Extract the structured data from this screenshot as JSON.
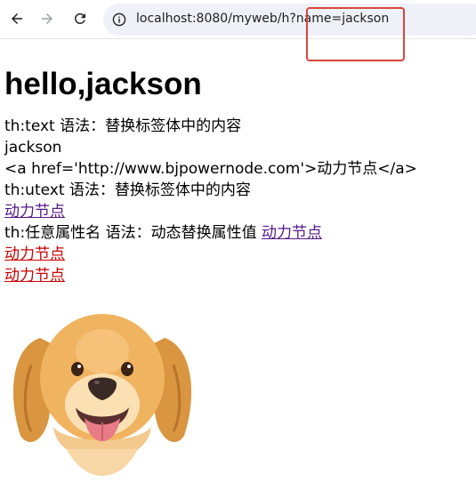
{
  "browser": {
    "url": "localhost:8080/myweb/h?name=jackson"
  },
  "page": {
    "heading": "hello,jackson",
    "lines": [
      "th:text 语法：替换标签体中的内容",
      "jackson",
      "<a href='http://www.bjpowernode.com'>动力节点</a>",
      "th:utext 语法：替换标签体中的内容"
    ],
    "utext_link": "动力节点",
    "attr_label": "th:任意属性名 语法：动态替换属性值 ",
    "attr_link": "动力节点",
    "red_link_1": "动力节点",
    "red_link_2": "动力节点"
  },
  "colors": {
    "visited_link": "#551a8b",
    "red_link": "#cc0000",
    "annotation_box": "#d9463a"
  }
}
